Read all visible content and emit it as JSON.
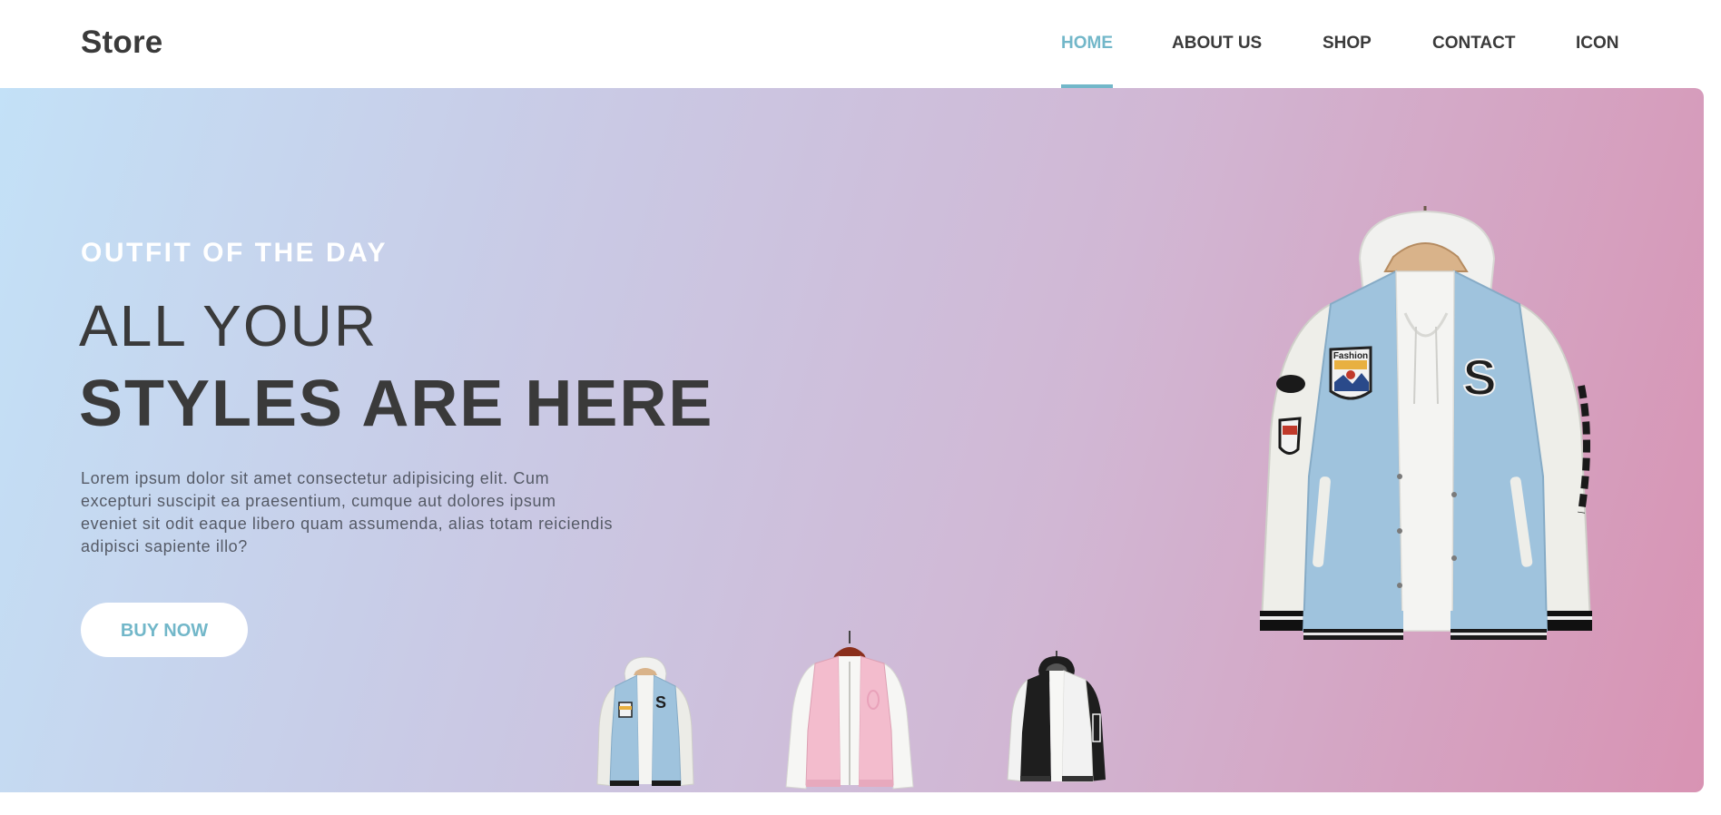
{
  "header": {
    "logo": "Store",
    "nav": [
      {
        "label": "HOME",
        "active": true
      },
      {
        "label": "ABOUT US",
        "active": false
      },
      {
        "label": "SHOP",
        "active": false
      },
      {
        "label": "CONTACT",
        "active": false
      },
      {
        "label": "ICON",
        "active": false
      }
    ]
  },
  "hero": {
    "eyebrow": "OUTFIT OF THE DAY",
    "headline_line1": "ALL YOUR",
    "headline_line2": "STYLES ARE HERE",
    "description": "Lorem ipsum dolor sit amet consectetur adipisicing elit. Cum excepturi suscipit ea praesentium, cumque aut dolores ipsum eveniet sit odit eaque libero quam assumenda, alias totam reiciendis adipisci sapiente illo?",
    "button_label": "BUY NOW",
    "main_product": {
      "icon": "blue-varsity-jacket-image",
      "patch_text": "Fashion",
      "letter": "S"
    },
    "thumbnails": [
      {
        "icon": "blue-varsity-jacket-thumbnail",
        "color": "#9fc3dd"
      },
      {
        "icon": "pink-varsity-jacket-thumbnail",
        "color": "#f0b9cb"
      },
      {
        "icon": "black-white-jacket-thumbnail",
        "color": "#1e1e1e"
      }
    ]
  },
  "colors": {
    "accent": "#72b7c9",
    "text_dark": "#3a3a3a",
    "gradient_start": "#c3e1f7",
    "gradient_end": "#d893b3"
  }
}
